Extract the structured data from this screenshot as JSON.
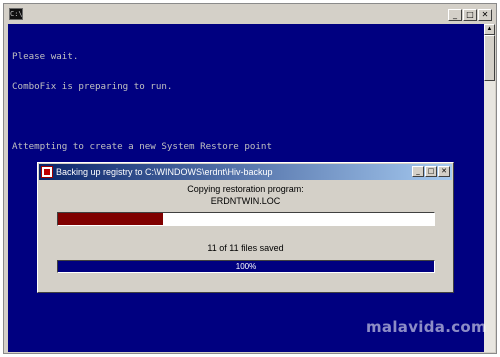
{
  "console": {
    "system_icon_text": "C:\\",
    "lines": [
      "Please wait.",
      "ComboFix is preparing to run.",
      "",
      "Attempting to create a new System Restore point"
    ],
    "background_color": "#000080",
    "text_color": "#c0c0c0"
  },
  "window_buttons": {
    "minimize": "_",
    "maximize": "□",
    "close": "✕"
  },
  "dialog": {
    "title": "Backing up registry to C:\\WINDOWS\\erdnt\\Hiv-backup",
    "status_line": "Copying restoration program:",
    "file_name": "ERDNTWIN.LOC",
    "copy_progress": 0.28,
    "copy_bar_color": "#800000",
    "files_saved_text": "11 of 11 files saved",
    "total_progress": 1.0,
    "total_progress_label": "100%",
    "total_bar_color": "#000080"
  },
  "watermark": "malavida.com"
}
